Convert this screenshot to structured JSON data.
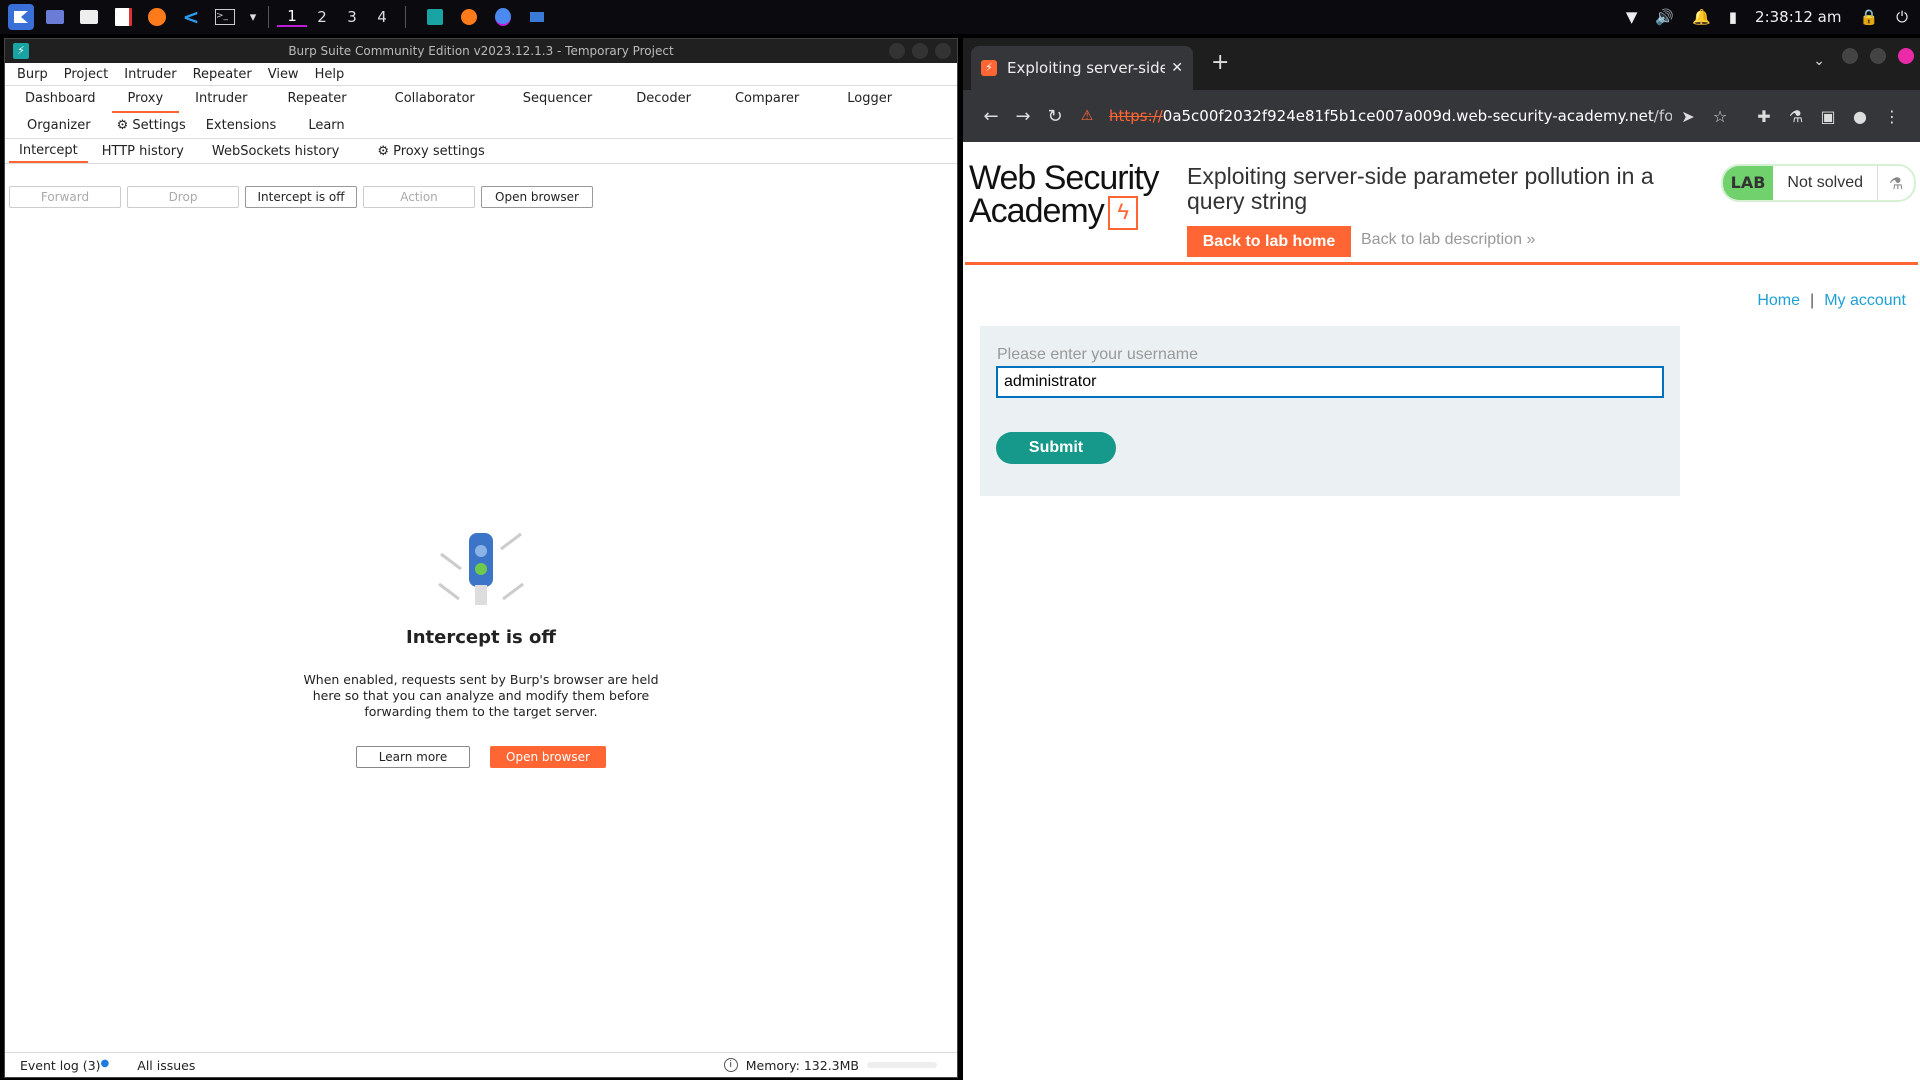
{
  "taskbar": {
    "workspaces": [
      "1",
      "2",
      "3",
      "4"
    ],
    "clock": "2:38:12 am",
    "icons": [
      "app-launcher-icon",
      "desktop-icon",
      "file-manager-icon",
      "document-icon",
      "firefox-icon",
      "vscode-icon",
      "terminal-icon"
    ]
  },
  "burp": {
    "window_title": "Burp Suite Community Edition v2023.12.1.3 - Temporary Project",
    "menu": [
      "Burp",
      "Project",
      "Intruder",
      "Repeater",
      "View",
      "Help"
    ],
    "tabs": [
      "Dashboard",
      "Proxy",
      "Intruder",
      "Repeater",
      "Collaborator",
      "Sequencer",
      "Decoder",
      "Comparer",
      "Logger",
      "Organizer",
      "Settings",
      "Extensions",
      "Learn"
    ],
    "active_tab": "Proxy",
    "subtabs": [
      "Intercept",
      "HTTP history",
      "WebSockets history",
      "Proxy settings"
    ],
    "active_subtab": "Intercept",
    "toolbar": {
      "forward": "Forward",
      "drop": "Drop",
      "intercept_toggle": "Intercept is off",
      "action": "Action",
      "open_browser": "Open browser"
    },
    "empty_state": {
      "heading": "Intercept is off",
      "description": "When enabled, requests sent by Burp's browser are held here so that you can analyze and modify them before forwarding them to the target server.",
      "learn_more": "Learn more",
      "open_browser": "Open browser"
    },
    "status": {
      "event_log": "Event log (3)",
      "all_issues": "All issues",
      "memory": "Memory: 132.3MB"
    }
  },
  "browser": {
    "tab_title": "Exploiting server-side pa",
    "url_scheme": "https://",
    "url_host": "0a5c00f2032f924e81f5b1ce007a009d.web-security-academy.net",
    "url_path": "/forgot-passw...",
    "page": {
      "logo_line1": "Web Security",
      "logo_line2": "Academy",
      "lab_title": "Exploiting server-side parameter pollution in a query string",
      "back_home": "Back to lab home",
      "back_description": "Back to lab description",
      "lab_badge": "LAB",
      "lab_status": "Not solved",
      "nav_home": "Home",
      "nav_separator": "|",
      "nav_account": "My account",
      "form_label": "Please enter your username",
      "username_value": "administrator",
      "submit": "Submit"
    }
  },
  "colors": {
    "accent": "#ff6633",
    "link": "#1ea0d6",
    "submit": "#16988a",
    "lab_badge": "#70d16d"
  }
}
